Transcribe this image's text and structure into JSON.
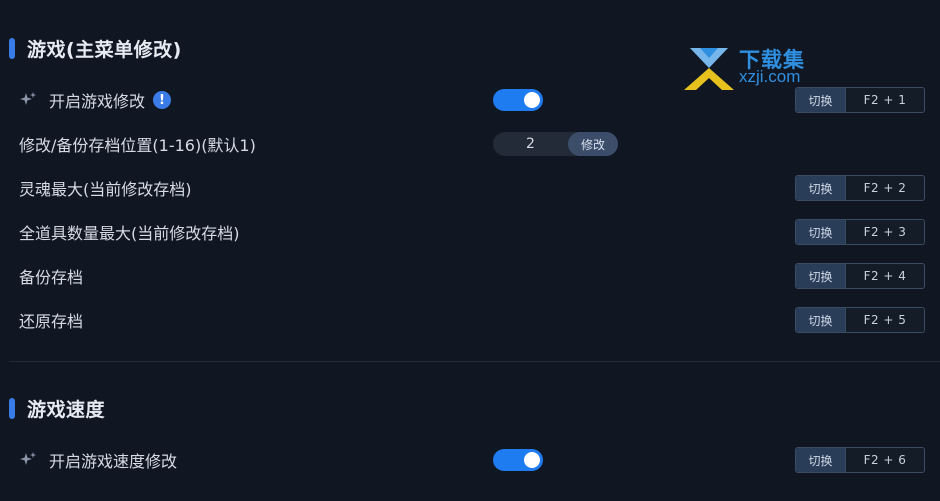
{
  "sections": [
    {
      "title": "游戏(主菜单修改)",
      "rows": [
        {
          "label": "开启游戏修改",
          "hotkey": "F2 + 1"
        },
        {
          "label": "修改/备份存档位置(1-16)(默认1)",
          "stepper_value": "2",
          "stepper_button": "修改"
        },
        {
          "label": "灵魂最大(当前修改存档)",
          "hotkey": "F2 + 2"
        },
        {
          "label": "全道具数量最大(当前修改存档)",
          "hotkey": "F2 + 3"
        },
        {
          "label": "备份存档",
          "hotkey": "F2 + 4"
        },
        {
          "label": "还原存档",
          "hotkey": "F2 + 5"
        }
      ]
    },
    {
      "title": "游戏速度",
      "rows": [
        {
          "label": "开启游戏速度修改",
          "hotkey": "F2 + 6"
        }
      ]
    }
  ],
  "hotkey_action_label": "切换",
  "info_badge_text": "!",
  "toggle_states": {
    "game_mod": true,
    "speed_mod": true
  },
  "watermark": {
    "title": "下载集",
    "url": "xzji.com"
  },
  "colors": {
    "background": "#101723",
    "accent": "#3a7ce6",
    "toggle_on": "#1f7bf0",
    "watermark": "#2f8fe0"
  },
  "icons": {
    "sparkle": "sparkle-icon",
    "info": "info-icon",
    "logo": "download-arrow-logo"
  }
}
